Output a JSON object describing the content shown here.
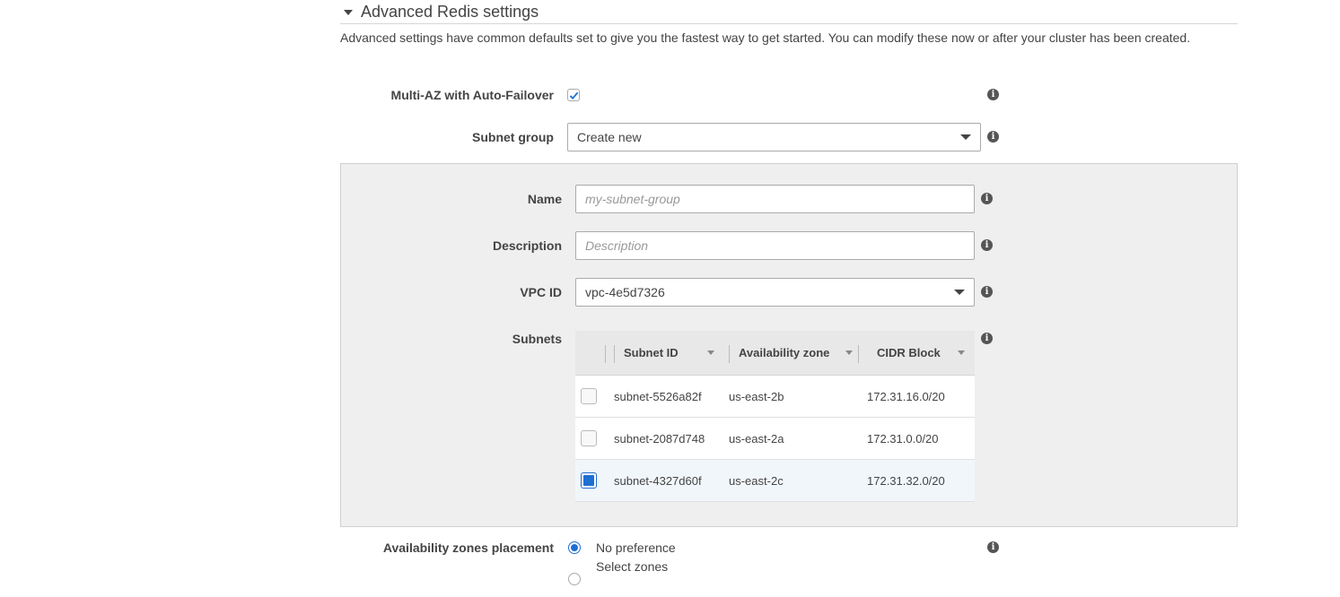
{
  "section": {
    "title": "Advanced Redis settings",
    "description": "Advanced settings have common defaults set to give you the fastest way to get started. You can modify these now or after your cluster has been created."
  },
  "multi_az": {
    "label": "Multi-AZ with Auto-Failover",
    "checked": true,
    "info_icon": "info-icon"
  },
  "subnet_group": {
    "label": "Subnet group",
    "value": "Create new"
  },
  "panel": {
    "name": {
      "label": "Name",
      "placeholder": "my-subnet-group",
      "value": ""
    },
    "description": {
      "label": "Description",
      "placeholder": "Description",
      "value": ""
    },
    "vpc": {
      "label": "VPC ID",
      "value": "vpc-4e5d7326"
    },
    "subnets": {
      "label": "Subnets",
      "columns": [
        "Subnet ID",
        "Availability zone",
        "CIDR Block"
      ],
      "rows": [
        {
          "id": "subnet-5526a82f",
          "zone": "us-east-2b",
          "cidr": "172.31.16.0/20",
          "selected": false
        },
        {
          "id": "subnet-2087d748",
          "zone": "us-east-2a",
          "cidr": "172.31.0.0/20",
          "selected": false
        },
        {
          "id": "subnet-4327d60f",
          "zone": "us-east-2c",
          "cidr": "172.31.32.0/20",
          "selected": true
        }
      ]
    }
  },
  "az_placement": {
    "label": "Availability zones placement",
    "options": [
      {
        "label": "No preference",
        "selected": true
      },
      {
        "label": "Select zones",
        "selected": false
      }
    ]
  },
  "colors": {
    "accent": "#1f6fd1",
    "panel_bg": "#efefef",
    "selected_row_bg": "#f1f6fb"
  }
}
